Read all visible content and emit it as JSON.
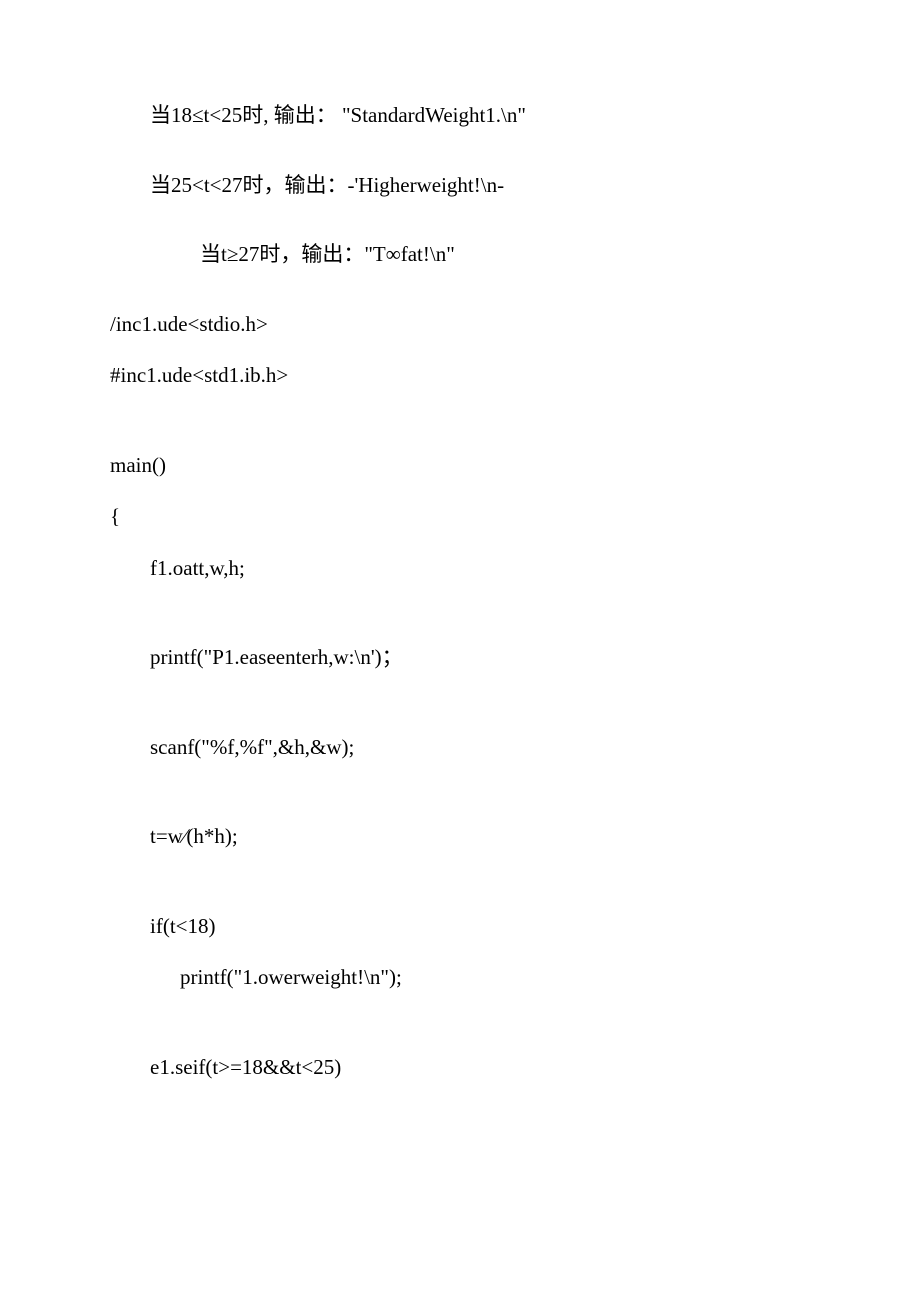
{
  "lines": {
    "l1": "当18≤t<25时, 输出： \"StandardWeight1.\\n\"",
    "l2": "当25<t<27时，输出：-'Higherweight!\\n-",
    "l3": "当t≥27时，输出：\"T∞fat!\\n\"",
    "l4": "/inc1.ude<stdio.h>",
    "l5": "#inc1.ude<std1.ib.h>",
    "l6": "main()",
    "l7": "{",
    "l8": "f1.oatt,w,h;",
    "l9": "printf(\"P1.easeenterh,w:\\n')；",
    "l10": "scanf(\"%f,%f\",&h,&w);",
    "l11": "t=w∕(h*h);",
    "l12": "if(t<18)",
    "l13": "printf(\"1.owerweight!\\n\");",
    "l14": "e1.seif(t>=18&&t<25)"
  }
}
